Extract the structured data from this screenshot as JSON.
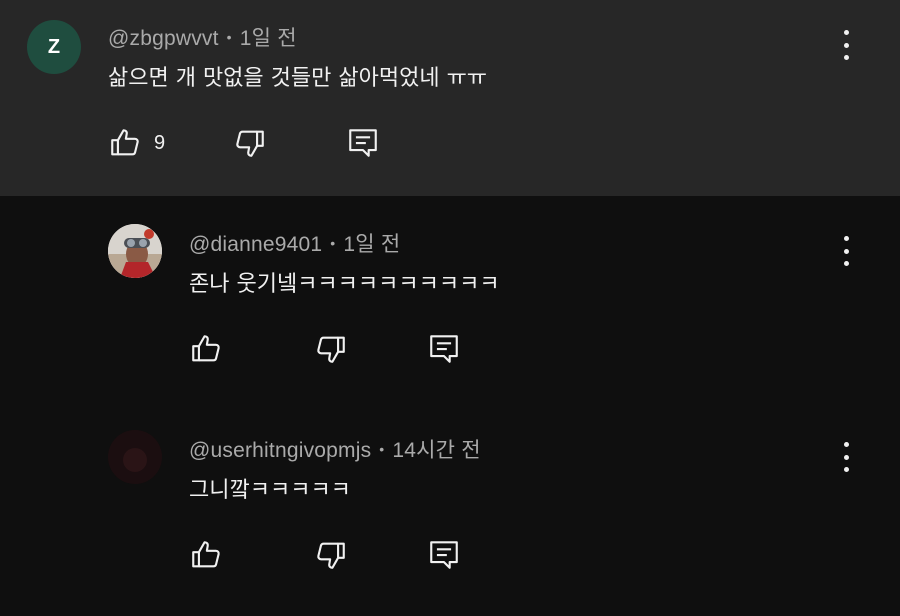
{
  "comments": [
    {
      "author": "@zbgpwvvt",
      "separator": "•",
      "time": "1일 전",
      "avatar_letter": "Z",
      "avatar_color": "#1f4d3f",
      "text": "삶으면 개 맛없을 것들만 삶아먹었네 ㅠㅠ",
      "like_count": "9"
    },
    {
      "author": "@dianne9401",
      "separator": "•",
      "time": "1일 전",
      "text": "존나 웃기넼ㅋㅋㅋㅋㅋㅋㅋㅋㅋㅋ"
    },
    {
      "author": "@userhitngivopmjs",
      "separator": "•",
      "time": "14시간 전",
      "text": "그니깤ㅋㅋㅋㅋㅋ"
    }
  ],
  "colors": {
    "background": "#0f0f0f",
    "highlight_background": "#272727",
    "text_primary": "#f1f1f1",
    "text_secondary": "#aaaaaa"
  },
  "icons": [
    "like-icon",
    "dislike-icon",
    "reply-icon",
    "more-vert-icon"
  ]
}
